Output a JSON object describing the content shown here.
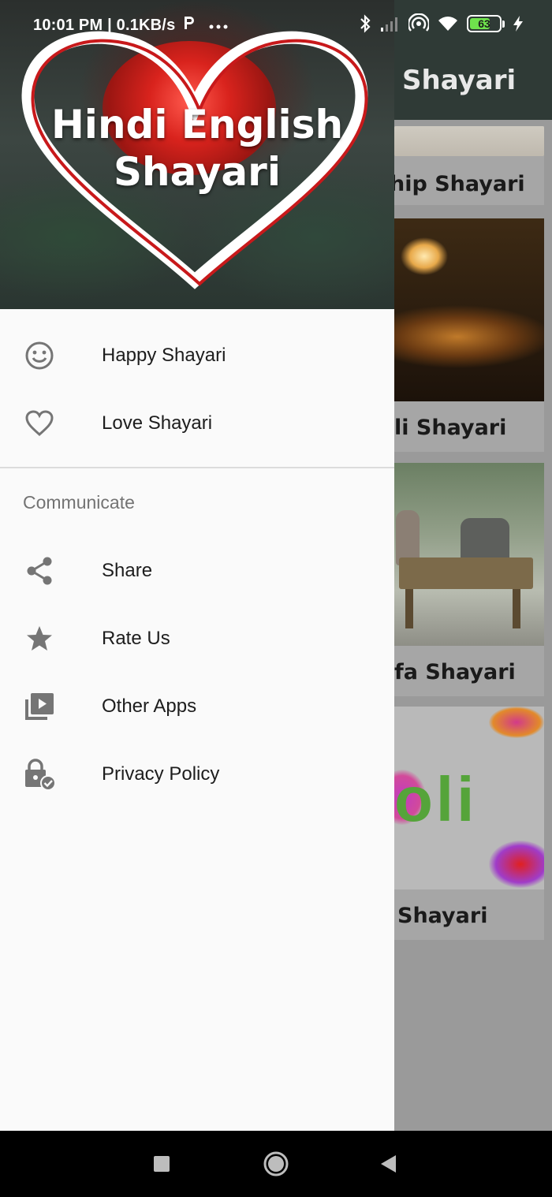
{
  "status_bar": {
    "time_speed": "10:01 PM | 0.1KB/s",
    "battery_level": "63"
  },
  "background_app": {
    "toolbar_title": "Shayari",
    "cards": [
      {
        "title_visible": "hip Shayari"
      },
      {
        "title_visible": "li Shayari"
      },
      {
        "title_visible": "fa Shayari"
      },
      {
        "title_visible": "Shayari"
      }
    ],
    "holi_text": "oli"
  },
  "drawer": {
    "header": {
      "line1": "Hindi English",
      "line2": "Shayari"
    },
    "items": [
      {
        "label": "Happy Shayari",
        "icon": "smiley-icon"
      },
      {
        "label": "Love Shayari",
        "icon": "heart-icon"
      }
    ],
    "section_title": "Communicate",
    "communicate_items": [
      {
        "label": "Share",
        "icon": "share-icon"
      },
      {
        "label": "Rate Us",
        "icon": "star-icon"
      },
      {
        "label": "Other Apps",
        "icon": "video-library-icon"
      },
      {
        "label": "Privacy Policy",
        "icon": "lock-check-icon"
      }
    ]
  },
  "colors": {
    "drawer_bg": "#fafafa",
    "icon_gray": "#757575",
    "battery_green": "#6fe34c"
  }
}
